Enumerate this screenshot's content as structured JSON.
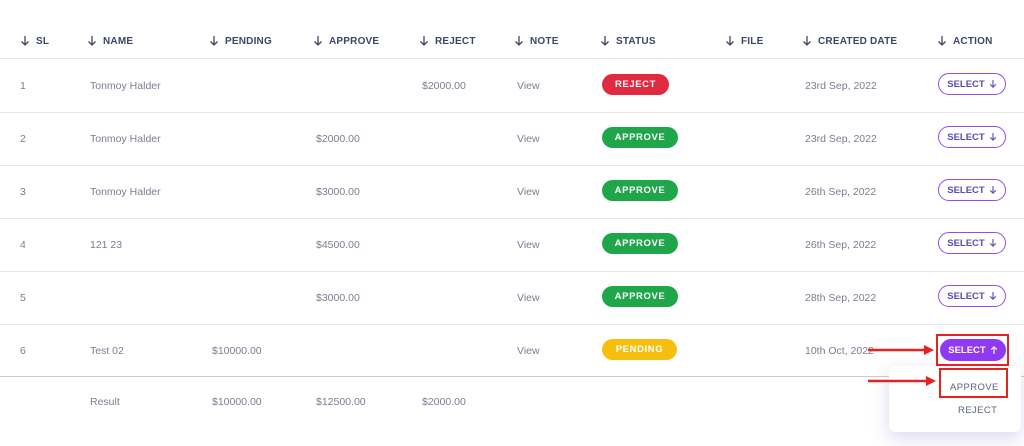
{
  "table": {
    "columns": [
      "SL",
      "NAME",
      "PENDING",
      "APPROVE",
      "REJECT",
      "NOTE",
      "STATUS",
      "FILE",
      "CREATED DATE",
      "ACTION"
    ],
    "rows": [
      {
        "sl": "1",
        "name": "Tonmoy Halder",
        "pending": "",
        "approve": "",
        "reject": "$2000.00",
        "note": "View",
        "status": "REJECT",
        "status_color": "#e02a3f",
        "created": "23rd Sep, 2022",
        "action": "SELECT"
      },
      {
        "sl": "2",
        "name": "Tonmoy Halder",
        "pending": "",
        "approve": "$2000.00",
        "reject": "",
        "note": "View",
        "status": "APPROVE",
        "status_color": "#1fa64a",
        "created": "23rd Sep, 2022",
        "action": "SELECT"
      },
      {
        "sl": "3",
        "name": "Tonmoy Halder",
        "pending": "",
        "approve": "$3000.00",
        "reject": "",
        "note": "View",
        "status": "APPROVE",
        "status_color": "#1fa64a",
        "created": "26th Sep, 2022",
        "action": "SELECT"
      },
      {
        "sl": "4",
        "name": "121 23",
        "pending": "",
        "approve": "$4500.00",
        "reject": "",
        "note": "View",
        "status": "APPROVE",
        "status_color": "#1fa64a",
        "created": "26th Sep, 2022",
        "action": "SELECT"
      },
      {
        "sl": "5",
        "name": "",
        "pending": "",
        "approve": "$3000.00",
        "reject": "",
        "note": "View",
        "status": "APPROVE",
        "status_color": "#1fa64a",
        "created": "28th Sep, 2022",
        "action": "SELECT"
      },
      {
        "sl": "6",
        "name": "Test 02",
        "pending": "$10000.00",
        "approve": "",
        "reject": "",
        "note": "View",
        "status": "PENDING",
        "status_color": "#f6bf0f",
        "created": "10th Oct, 2022",
        "action": "SELECT"
      }
    ],
    "footer": {
      "label": "Result",
      "pending": "$10000.00",
      "approve": "$12500.00",
      "reject": "$2000.00"
    }
  },
  "dropdown": {
    "options": [
      "APPROVE",
      "REJECT"
    ]
  },
  "colors": {
    "accent": "#9039f5",
    "annotation": "#e2231f"
  }
}
